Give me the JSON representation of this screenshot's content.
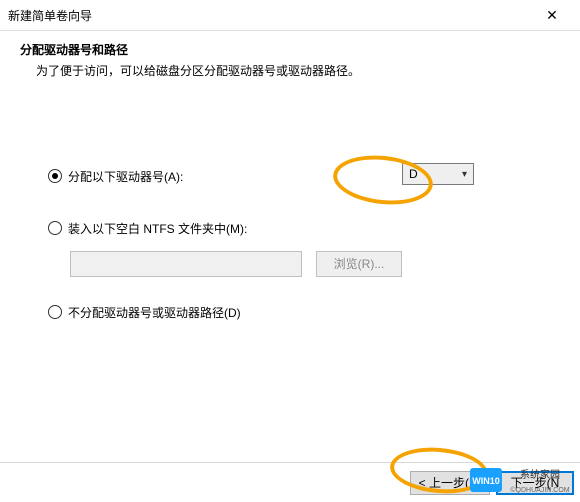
{
  "window": {
    "title": "新建简单卷向导",
    "close_glyph": "✕"
  },
  "header": {
    "title": "分配驱动器号和路径",
    "desc": "为了便于访问，可以给磁盘分区分配驱动器号或驱动器路径。"
  },
  "options": {
    "assign_letter": {
      "label": "分配以下驱动器号(A):",
      "checked": true
    },
    "drive_letter": "D",
    "mount_path": {
      "label": "装入以下空白 NTFS 文件夹中(M):",
      "checked": false
    },
    "browse_label": "浏览(R)...",
    "no_assign": {
      "label": "不分配驱动器号或驱动器路径(D)",
      "checked": false
    },
    "path_value": ""
  },
  "footer": {
    "back": "< 上一步(B)",
    "next": "下一步(N"
  },
  "watermark": {
    "line1": "WIN10 系统家园",
    "line2": "©QDHUAJIN.COM"
  }
}
